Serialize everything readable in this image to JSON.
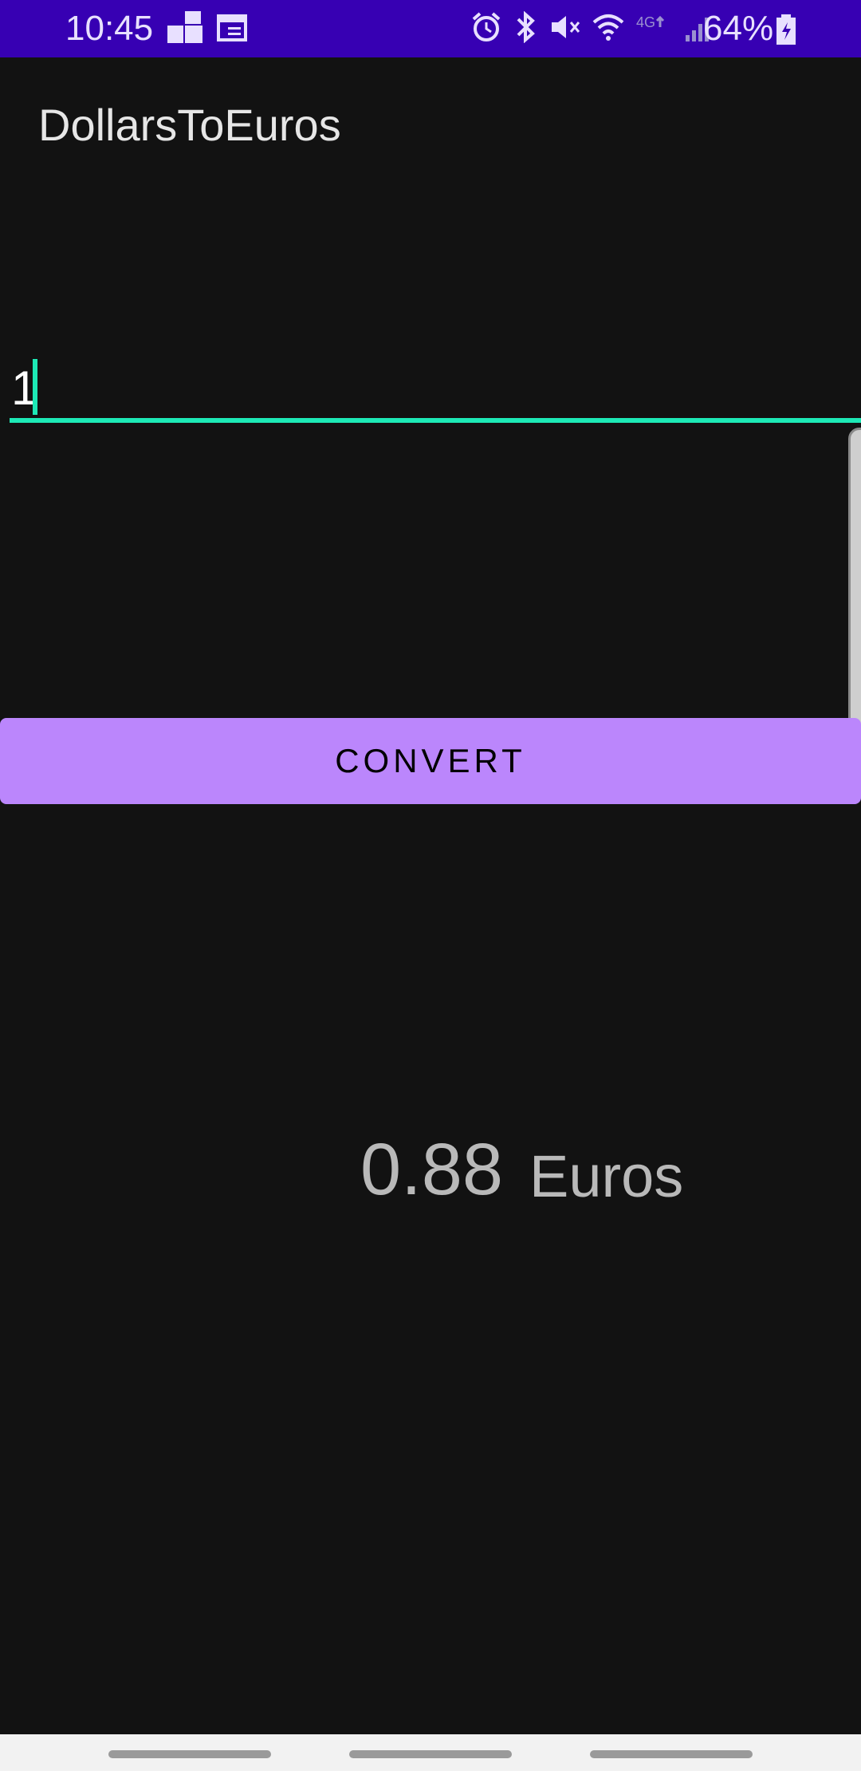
{
  "status_bar": {
    "time": "10:45",
    "battery_text": "64%",
    "icons": [
      "gallery-icon",
      "calendar-icon",
      "alarm-icon",
      "bluetooth-icon",
      "mute-icon",
      "wifi-icon",
      "lte-icon",
      "signal-icon",
      "battery-icon"
    ],
    "background": "#3700b3"
  },
  "app_bar": {
    "title": "DollarsToEuros"
  },
  "input": {
    "value": "1",
    "accent": "#1de9b6"
  },
  "convert_button": {
    "label": "CONVERT",
    "color": "#bb86fc"
  },
  "result": {
    "value": "0.88",
    "unit": "Euros"
  },
  "nav_bar": {
    "handles": [
      "back-handle",
      "home-handle",
      "recents-handle"
    ]
  }
}
